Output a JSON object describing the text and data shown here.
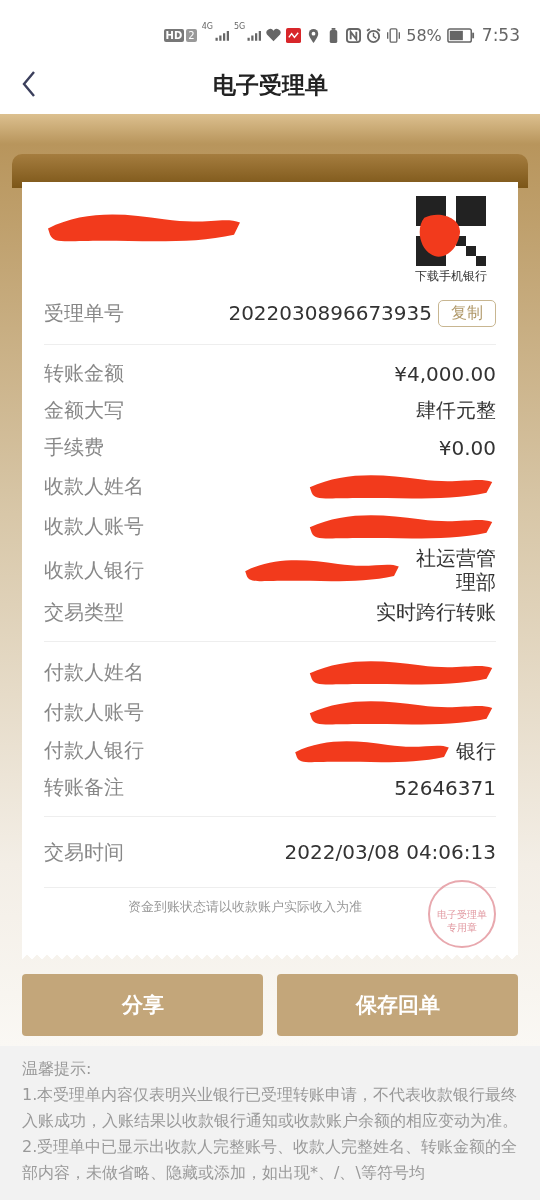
{
  "status_bar": {
    "hd": "HD",
    "sim": "2",
    "net_a": "4G",
    "net_b": "5G",
    "battery": "58%",
    "time": "7:53"
  },
  "header": {
    "title": "电子受理单"
  },
  "receipt": {
    "logo_redacted": true,
    "qr_redacted": true,
    "qr_caption": "下载手机银行",
    "order": {
      "label": "受理单号",
      "value": "2022030896673935",
      "copy_button": "复制"
    },
    "sections": [
      [
        {
          "label": "转账金额",
          "value": "¥4,000.00",
          "redacted": false
        },
        {
          "label": "金额大写",
          "value": "肆仟元整",
          "redacted": false
        },
        {
          "label": "手续费",
          "value": "¥0.00",
          "redacted": false
        },
        {
          "label": "收款人姓名",
          "redacted": true
        },
        {
          "label": "收款人账号",
          "redacted": true
        },
        {
          "label": "收款人银行",
          "value": "社运营管理部",
          "redacted": true
        },
        {
          "label": "交易类型",
          "value": "实时跨行转账",
          "redacted": false
        }
      ],
      [
        {
          "label": "付款人姓名",
          "redacted": true
        },
        {
          "label": "付款人账号",
          "redacted": true
        },
        {
          "label": "付款人银行",
          "value": "银行",
          "redacted": true
        },
        {
          "label": "转账备注",
          "value": "52646371",
          "redacted": false
        }
      ],
      [
        {
          "label": "交易时间",
          "value": "2022/03/08 04:06:13",
          "redacted": false
        }
      ]
    ],
    "stamp": {
      "line_1": "电子受理单",
      "line_2": "专用章"
    },
    "notice": "资金到账状态请以收款账户实际收入为准"
  },
  "buttons": [
    {
      "label": "分享"
    },
    {
      "label": "保存回单"
    }
  ],
  "tips": {
    "title": "温馨提示:",
    "items": [
      "1.本受理单内容仅表明兴业银行已受理转账申请，不代表收款银行最终入账成功，入账结果以收款银行通知或收款账户余额的相应变动为准。",
      "2.受理单中已显示出收款人完整账号、收款人完整姓名、转账金额的全部内容，未做省略、隐藏或添加，如出现*、/、\\等符号均"
    ]
  }
}
